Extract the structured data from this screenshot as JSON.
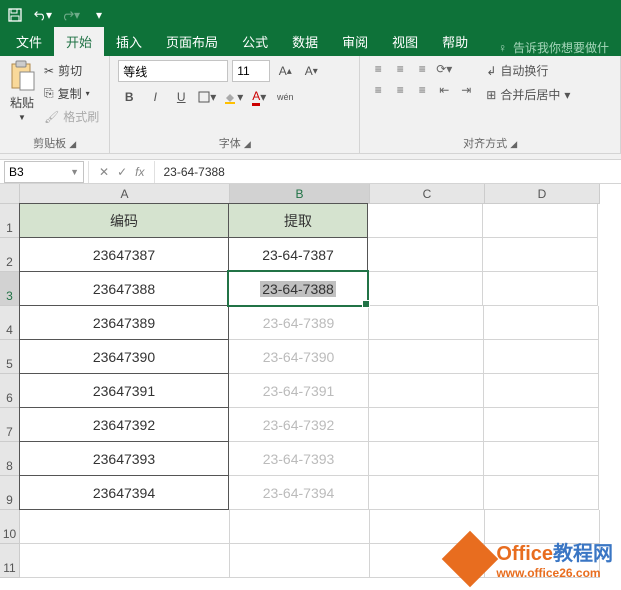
{
  "titlebar": {
    "save_icon": "save",
    "undo_icon": "undo",
    "redo_icon": "redo"
  },
  "tabs": {
    "file": "文件",
    "home": "开始",
    "insert": "插入",
    "layout": "页面布局",
    "formula": "公式",
    "data": "数据",
    "review": "审阅",
    "view": "视图",
    "help": "帮助",
    "search_placeholder": "告诉我你想要做什"
  },
  "ribbon": {
    "clipboard": {
      "paste": "粘贴",
      "cut": "剪切",
      "copy": "复制",
      "format_painter": "格式刷",
      "label": "剪贴板"
    },
    "font": {
      "name": "等线",
      "size": "11",
      "bold": "B",
      "italic": "I",
      "underline": "U",
      "wen": "wén",
      "label": "字体"
    },
    "align": {
      "wrap": "自动换行",
      "merge": "合并后居中",
      "label": "对齐方式"
    }
  },
  "formulabar": {
    "namebox": "B3",
    "formula": "23-64-7388"
  },
  "columns": [
    "A",
    "B",
    "C",
    "D"
  ],
  "rows": [
    "1",
    "2",
    "3",
    "4",
    "5",
    "6",
    "7",
    "8",
    "9",
    "10",
    "11"
  ],
  "headers": {
    "a": "编码",
    "b": "提取"
  },
  "data_rows": [
    {
      "a": "23647387",
      "b": "23-64-7387",
      "faded": false
    },
    {
      "a": "23647388",
      "b": "23-64-7388",
      "faded": false
    },
    {
      "a": "23647389",
      "b": "23-64-7389",
      "faded": true
    },
    {
      "a": "23647390",
      "b": "23-64-7390",
      "faded": true
    },
    {
      "a": "23647391",
      "b": "23-64-7391",
      "faded": true
    },
    {
      "a": "23647392",
      "b": "23-64-7392",
      "faded": true
    },
    {
      "a": "23647393",
      "b": "23-64-7393",
      "faded": true
    },
    {
      "a": "23647394",
      "b": "23-64-7394",
      "faded": true
    }
  ],
  "watermark": {
    "brand": "Office",
    "suffix": "教程网",
    "url": "www.office26.com"
  }
}
